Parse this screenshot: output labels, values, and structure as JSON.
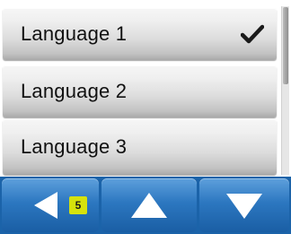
{
  "language_list": {
    "items": [
      {
        "label": "Language 1",
        "selected": true
      },
      {
        "label": "Language 2",
        "selected": false
      },
      {
        "label": "Language 3",
        "selected": false
      }
    ],
    "selected_icon": "checkmark-icon"
  },
  "navigation": {
    "back": {
      "icon": "left-triangle-icon",
      "badge": "5"
    },
    "up": {
      "icon": "up-triangle-icon"
    },
    "down": {
      "icon": "down-triangle-icon"
    }
  },
  "colors": {
    "nav_background": "#1b63a9",
    "button_top": "#5ea0dc",
    "button_bottom": "#1a5ea4",
    "badge": "#d6e20c"
  }
}
